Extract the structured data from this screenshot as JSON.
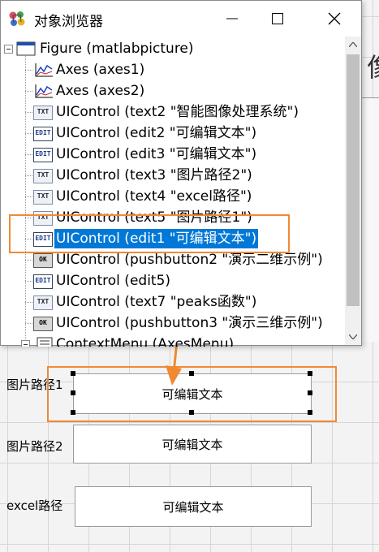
{
  "window": {
    "title": "对象浏览器",
    "title_icon": "object-browser-icon",
    "controls": {
      "minimize": "minimize-icon",
      "maximize": "maximize-icon",
      "close": "close-icon"
    }
  },
  "tree": {
    "root": "Figure (matlabpicture)",
    "items": [
      {
        "label": "Axes (axes1)",
        "icon": "axes-icon"
      },
      {
        "label": "Axes (axes2)",
        "icon": "axes-icon"
      },
      {
        "label": "UIControl (text2 \"智能图像处理系统\")",
        "icon": "text-icon"
      },
      {
        "label": "UIControl (edit2 \"可编辑文本\")",
        "icon": "edit-icon"
      },
      {
        "label": "UIControl (edit3 \"可编辑文本\")",
        "icon": "edit-icon"
      },
      {
        "label": "UIControl (text3 \"图片路径2\")",
        "icon": "text-icon"
      },
      {
        "label": "UIControl (text4 \"excel路径\")",
        "icon": "text-icon"
      },
      {
        "label": "UIControl (text5 \"图片路径1\")",
        "icon": "text-icon"
      },
      {
        "label": "UIControl (edit1 \"可编辑文本\")",
        "icon": "edit-icon",
        "selected": true
      },
      {
        "label": "UIControl (pushbutton2 \"演示二维示例\")",
        "icon": "pushbutton-icon"
      },
      {
        "label": "UIControl (edit5)",
        "icon": "edit-icon"
      },
      {
        "label": "UIControl (text7 \"peaks函数\")",
        "icon": "text-icon"
      },
      {
        "label": "UIControl (pushbutton3 \"演示三维示例\")",
        "icon": "pushbutton-icon"
      },
      {
        "label": "ContextMenu (AxesMenu)",
        "icon": "context-menu-icon"
      }
    ]
  },
  "editor": {
    "right_partial_char": "像",
    "rows": [
      {
        "label": "图片路径1",
        "box_text": "可编辑文本"
      },
      {
        "label": "图片路径2",
        "box_text": "可编辑文本"
      },
      {
        "label": "excel路径",
        "box_text": "可编辑文本"
      }
    ]
  },
  "colors": {
    "highlight_orange": "#ef8a33",
    "selection_blue": "#0078d7"
  }
}
